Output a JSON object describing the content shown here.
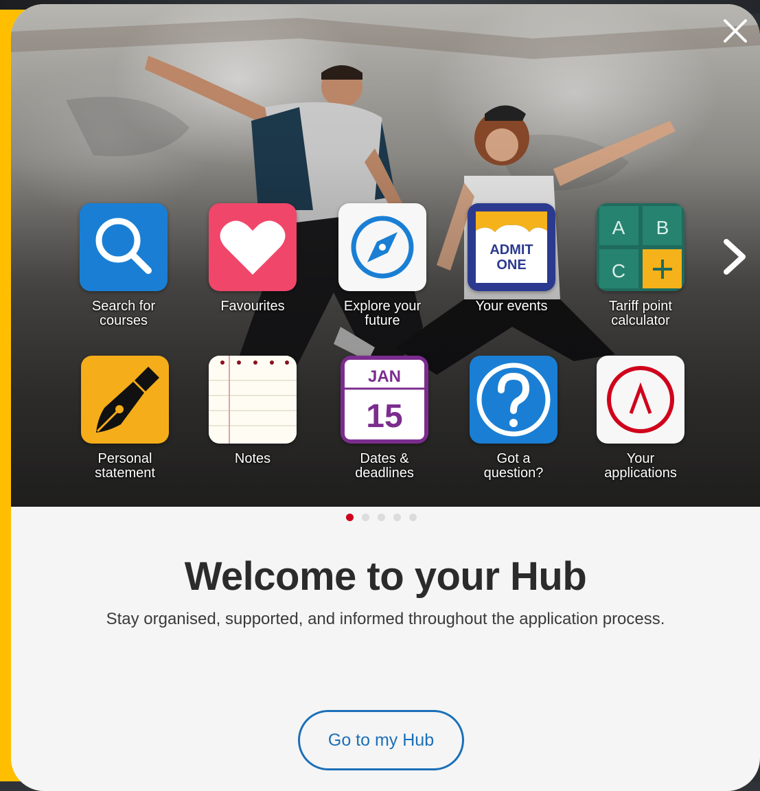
{
  "modal": {
    "close_icon": "close-icon",
    "next_icon": "chevron-right-icon",
    "title": "Welcome to your Hub",
    "subtitle": "Stay organised, supported, and informed throughout the application process.",
    "cta_label": "Go to my Hub",
    "carousel": {
      "pages": 5,
      "active_page": 1
    },
    "colors": {
      "accent_yellow": "#ffbf00",
      "cta_blue": "#1b6fb8",
      "active_dot": "#d0021b",
      "inactive_dot": "#dcdcdc"
    }
  },
  "tiles": [
    {
      "label": "Search for\ncourses",
      "icon": "search-icon"
    },
    {
      "label": "Favourites",
      "icon": "heart-icon"
    },
    {
      "label": "Explore your\nfuture",
      "icon": "compass-icon"
    },
    {
      "label": "Your events",
      "icon": "ticket-icon",
      "icon_text": [
        "ADMIT",
        "ONE"
      ]
    },
    {
      "label": "Tariff point\ncalculator",
      "icon": "calculator-icon",
      "icon_text": [
        "A",
        "B",
        "C"
      ]
    },
    {
      "label": "Personal\nstatement",
      "icon": "fountain-pen-icon"
    },
    {
      "label": "Notes",
      "icon": "notepad-icon"
    },
    {
      "label": "Dates &\ndeadlines",
      "icon": "calendar-icon",
      "icon_text": [
        "JAN",
        "15"
      ]
    },
    {
      "label": "Got a\nquestion?",
      "icon": "question-icon"
    },
    {
      "label": "Your\napplications",
      "icon": "ucas-logo-icon"
    }
  ]
}
